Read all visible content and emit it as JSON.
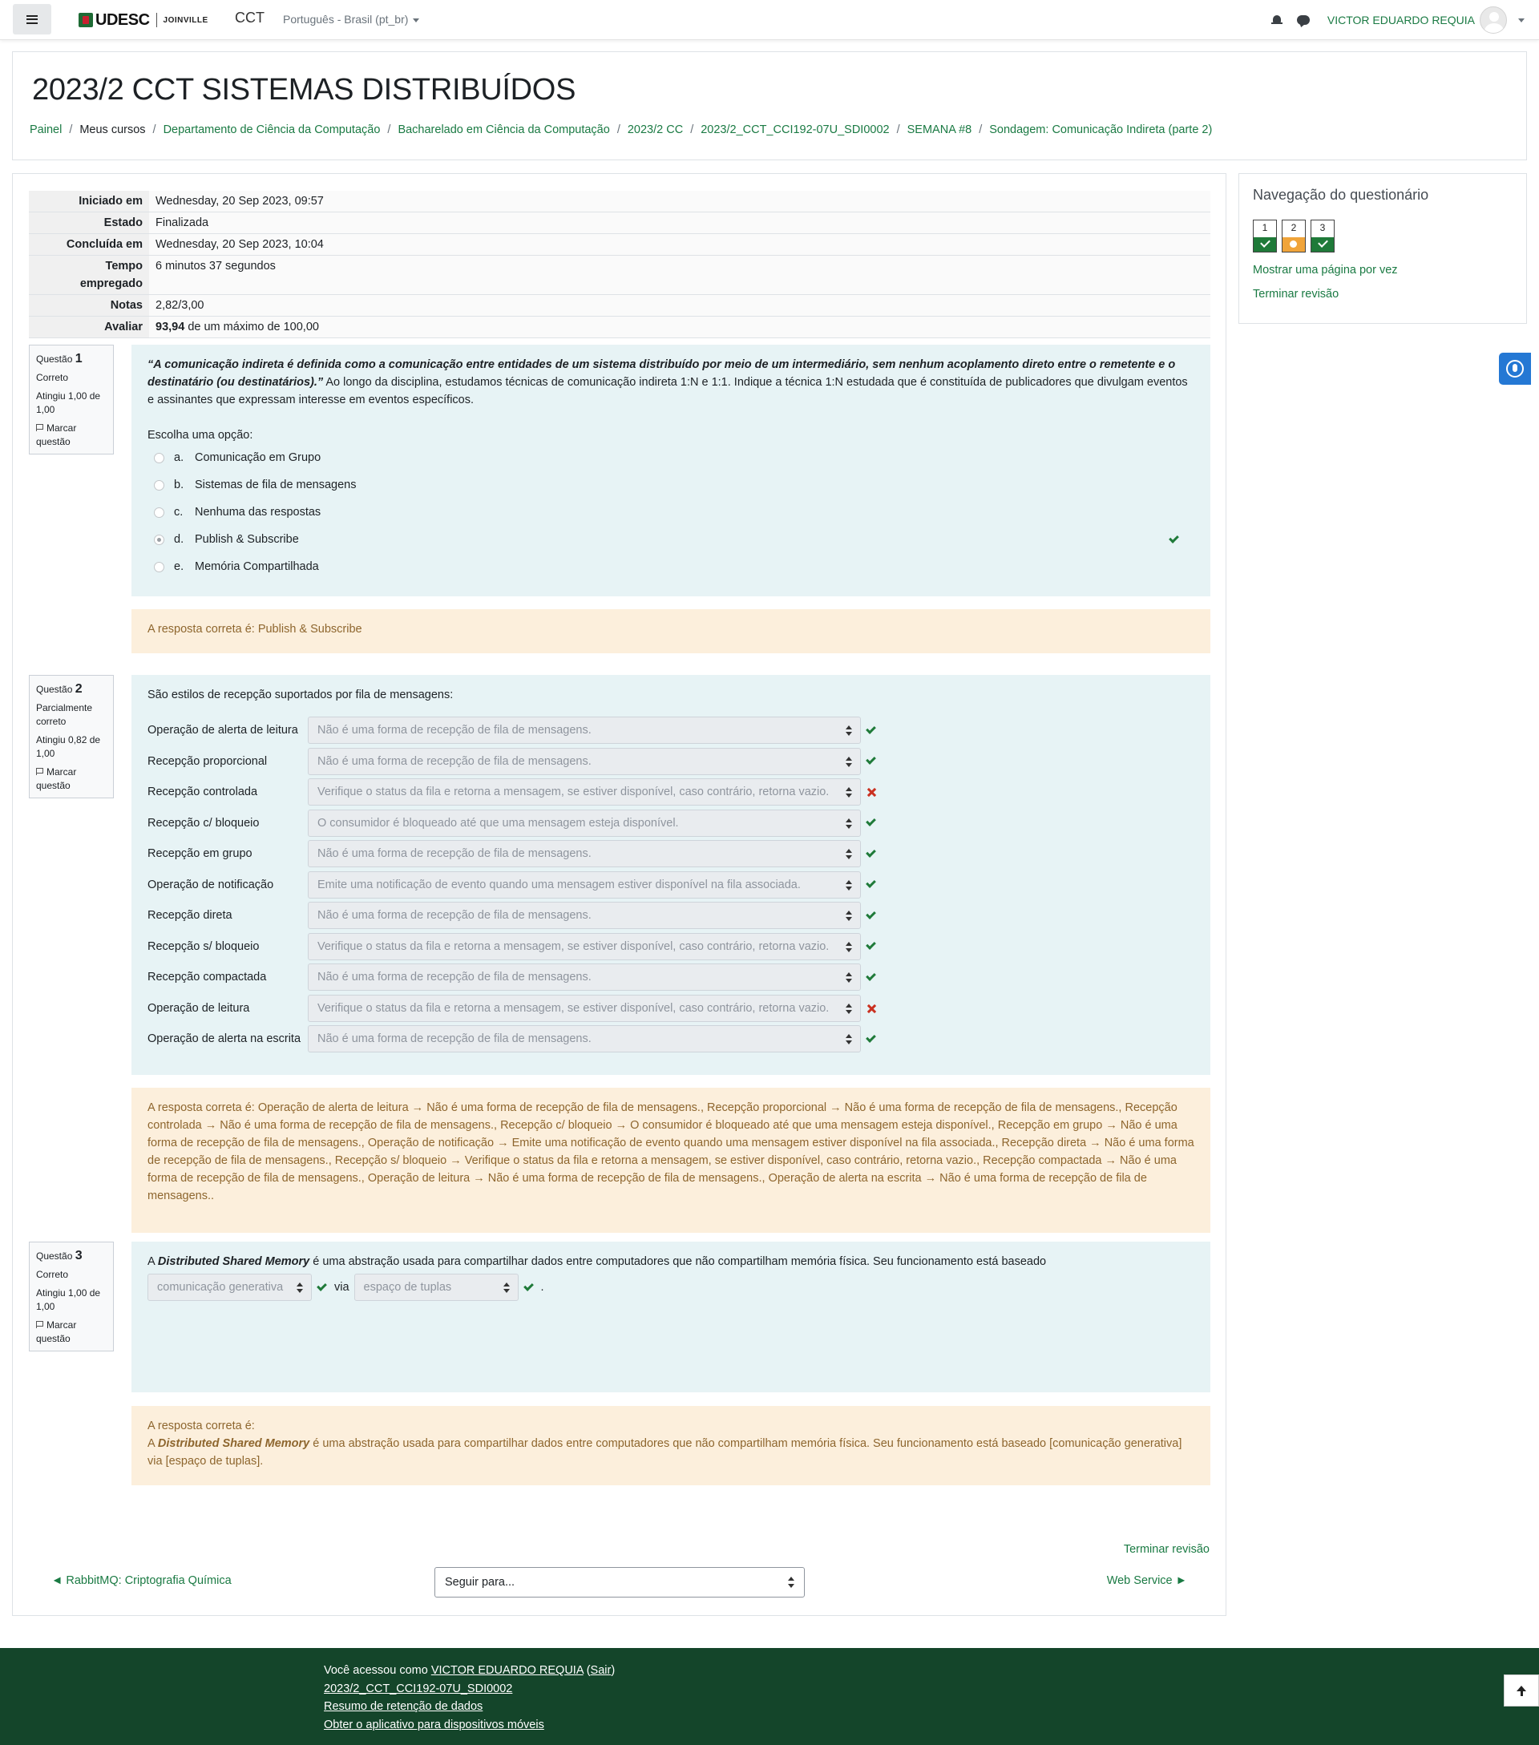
{
  "navbar": {
    "brand": "UDESC",
    "brand_city": "JOINVILLE",
    "site_name": "CCT",
    "language": "Português - Brasil (pt_br)",
    "user_name": "VICTOR EDUARDO REQUIA"
  },
  "header": {
    "title": "2023/2 CCT SISTEMAS DISTRIBUÍDOS",
    "breadcrumbs": [
      {
        "label": "Painel",
        "link": true
      },
      {
        "label": "Meus cursos",
        "link": false
      },
      {
        "label": "Departamento de Ciência da Computação",
        "link": true
      },
      {
        "label": "Bacharelado em Ciência da Computação",
        "link": true
      },
      {
        "label": "2023/2 CC",
        "link": true
      },
      {
        "label": "2023/2_CCT_CCI192-07U_SDI0002",
        "link": true
      },
      {
        "label": "SEMANA #8",
        "link": true
      },
      {
        "label": "Sondagem: Comunicação Indireta (parte 2)",
        "link": true
      }
    ]
  },
  "summary": {
    "started_label": "Iniciado em",
    "started_value": "Wednesday, 20 Sep 2023, 09:57",
    "state_label": "Estado",
    "state_value": "Finalizada",
    "completed_label": "Concluída em",
    "completed_value": "Wednesday, 20 Sep 2023, 10:04",
    "time_label_1": "Tempo",
    "time_label_2": "empregado",
    "time_value": "6 minutos 37 segundos",
    "marks_label": "Notas",
    "marks_value": "2,82/3,00",
    "grade_label": "Avaliar",
    "grade_bold": "93,94",
    "grade_rest": " de um máximo de 100,00"
  },
  "questions": {
    "q1": {
      "label": "Questão",
      "number": "1",
      "state": "Correto",
      "grade": "Atingiu 1,00 de 1,00",
      "flag": "Marcar questão",
      "text_em": "“A comunicação indireta é definida como a comunicação entre entidades de um sistema distribuído por meio de um intermediário, sem nenhum acoplamento direto entre o remetente e o destinatário (ou destinatários).”",
      "text_rest": " Ao longo da disciplina, estudamos técnicas de comunicação indireta 1:N e 1:1. Indique a técnica 1:N estudada que é constituída de publicadores que divulgam eventos e assinantes que expressam interesse em eventos específicos.",
      "prompt": "Escolha uma opção:",
      "options": [
        {
          "letter": "a.",
          "text": "Comunicação em Grupo"
        },
        {
          "letter": "b.",
          "text": "Sistemas de fila de mensagens"
        },
        {
          "letter": "c.",
          "text": "Nenhuma das respostas"
        },
        {
          "letter": "d.",
          "text": "Publish & Subscribe"
        },
        {
          "letter": "e.",
          "text": "Memória Compartilhada"
        }
      ],
      "feedback": "A resposta correta é: Publish & Subscribe"
    },
    "q2": {
      "label": "Questão",
      "number": "2",
      "state": "Parcialmente correto",
      "grade": "Atingiu 0,82 de 1,00",
      "flag": "Marcar questão",
      "text": "São estilos de recepção suportados por fila de mensagens:",
      "rows": [
        {
          "label": "Operação de alerta de leitura",
          "value": "Não é uma forma de recepção de fila de mensagens.",
          "correct": true
        },
        {
          "label": "Recepção proporcional",
          "value": "Não é uma forma de recepção de fila de mensagens.",
          "correct": true
        },
        {
          "label": "Recepção controlada",
          "value": "Verifique o status da fila e retorna a mensagem, se estiver disponível, caso contrário, retorna vazio.",
          "correct": false
        },
        {
          "label": "Recepção c/ bloqueio",
          "value": "O consumidor é bloqueado até que uma mensagem esteja disponível.",
          "correct": true
        },
        {
          "label": "Recepção em grupo",
          "value": "Não é uma forma de recepção de fila de mensagens.",
          "correct": true
        },
        {
          "label": "Operação de notificação",
          "value": "Emite uma notificação de evento quando uma mensagem estiver disponível na fila associada.",
          "correct": true
        },
        {
          "label": "Recepção direta",
          "value": "Não é uma forma de recepção de fila de mensagens.",
          "correct": true
        },
        {
          "label": "Recepção s/ bloqueio",
          "value": "Verifique o status da fila e retorna a mensagem, se estiver disponível, caso contrário, retorna vazio.",
          "correct": true
        },
        {
          "label": "Recepção compactada",
          "value": "Não é uma forma de recepção de fila de mensagens.",
          "correct": true
        },
        {
          "label": "Operação de leitura",
          "value": "Verifique o status da fila e retorna a mensagem, se estiver disponível, caso contrário, retorna vazio.",
          "correct": false
        },
        {
          "label": "Operação de alerta na escrita",
          "value": "Não é uma forma de recepção de fila de mensagens.",
          "correct": true
        }
      ],
      "feedback": "A resposta correta é: Operação de alerta de leitura → Não é uma forma de recepção de fila de mensagens., Recepção proporcional → Não é uma forma de recepção de fila de mensagens., Recepção controlada → Não é uma forma de recepção de fila de mensagens., Recepção c/ bloqueio → O consumidor é bloqueado até que uma mensagem esteja disponível., Recepção em grupo → Não é uma forma de recepção de fila de mensagens., Operação de notificação → Emite uma notificação de evento quando uma mensagem estiver disponível na fila associada., Recepção direta → Não é uma forma de recepção de fila de mensagens., Recepção s/ bloqueio → Verifique o status da fila e retorna a mensagem, se estiver disponível, caso contrário, retorna vazio., Recepção compactada → Não é uma forma de recepção de fila de mensagens., Operação de leitura → Não é uma forma de recepção de fila de mensagens., Operação de alerta na escrita → Não é uma forma de recepção de fila de mensagens.."
    },
    "q3": {
      "label": "Questão",
      "number": "3",
      "state": "Correto",
      "grade": "Atingiu 1,00 de 1,00",
      "flag": "Marcar questão",
      "text_a": "A ",
      "text_em": "Distributed Shared Memory",
      "text_rest": " é uma abstração usada para compartilhar dados entre computadores que não compartilham memória física. Seu funcionamento está baseado",
      "select1": "comunicação generativa",
      "via": "via",
      "select2": "espaço de tuplas",
      "period": ".",
      "feedback_title": "A resposta correta é:",
      "feedback_a": "A ",
      "feedback_em": "Distributed Shared Memory",
      "feedback_rest": " é uma abstração usada para compartilhar dados entre computadores que não compartilham memória física. Seu funcionamento está baseado [comunicação generativa] via [espaço de tuplas]."
    }
  },
  "bottom_nav": {
    "finish_review": "Terminar revisão",
    "prev": "◄ RabbitMQ: Criptografia Química",
    "jump": "Seguir para...",
    "next": "Web Service ►"
  },
  "side": {
    "title": "Navegação do questionário",
    "buttons": [
      {
        "num": "1",
        "status": "ok"
      },
      {
        "num": "2",
        "status": "partial"
      },
      {
        "num": "3",
        "status": "ok"
      }
    ],
    "show_one_page": "Mostrar uma página por vez",
    "finish_review": "Terminar revisão"
  },
  "footer": {
    "logged_as": "Você acessou como ",
    "user_link": "VICTOR EDUARDO REQUIA",
    "logout": "Sair",
    "course_link": "2023/2_CCT_CCI192-07U_SDI0002",
    "data_retention": "Resumo de retenção de dados",
    "mobile_app": "Obter o aplicativo para dispositivos móveis"
  },
  "colors": {
    "link_green": "#1a7a43",
    "question_bg": "#e7f3f5",
    "feedback_bg": "#fcefdc",
    "correct": "#1f7a39",
    "incorrect": "#ca3120",
    "partial": "#f0a43a",
    "footer_bg": "#14452a"
  }
}
